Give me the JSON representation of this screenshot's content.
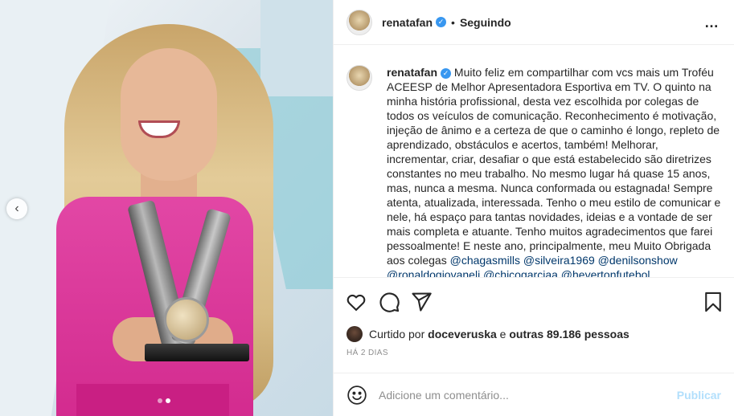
{
  "post": {
    "username": "renatafan",
    "follow_status": "Seguindo",
    "separator": "•",
    "more_icon": "…"
  },
  "media": {
    "prev_icon": "‹",
    "slides": 2,
    "active_slide": 2
  },
  "caption": {
    "username": "renatafan",
    "text": "Muito feliz em compartilhar com vcs mais um Troféu ACEESP de Melhor Apresentadora Esportiva em TV. O quinto na minha história profissional, desta vez escolhida por colegas de todos os veículos de comunicação. Reconhecimento é motivação, injeção de ânimo e a certeza de que o caminho é longo, repleto de aprendizado, obstáculos e acertos, também! Melhorar, incrementar, criar, desafiar o que está estabelecido são diretrizes constantes no meu trabalho. No mesmo lugar há quase 15 anos, mas, nunca a mesma. Nunca conformada ou estagnada! Sempre atenta, atualizada, interessada. Tenho o meu estilo de comunicar e nele, há espaço para tantas novidades, ideias e a vontade de ser mais completa e atuante. Tenho muitos agradecimentos que farei pessoalmente! E neste ano, principalmente, meu Muito Obrigada aos colegas",
    "mentions": [
      "@chagasmills",
      "@silveira1969",
      "@denilsonshow",
      "@ronaldogiovaneli",
      "@chicogarciaa",
      "@hevertonfutebol"
    ]
  },
  "likes": {
    "prefix": "Curtido por",
    "user": "doceveruska",
    "connector": "e",
    "others": "outras 89.186 pessoas"
  },
  "timestamp": "HÁ 2 DIAS",
  "comment": {
    "placeholder": "Adicione um comentário...",
    "publish_label": "Publicar"
  },
  "colors": {
    "verified": "#3897f0",
    "mention": "#00376b",
    "publish_disabled": "#b2dffc",
    "muted": "#8e8e8e"
  },
  "icons": {
    "like": "heart-icon",
    "comment": "comment-bubble-icon",
    "share": "paper-plane-icon",
    "save": "bookmark-icon",
    "emoji": "smiley-icon",
    "verified": "verified-badge-icon"
  }
}
